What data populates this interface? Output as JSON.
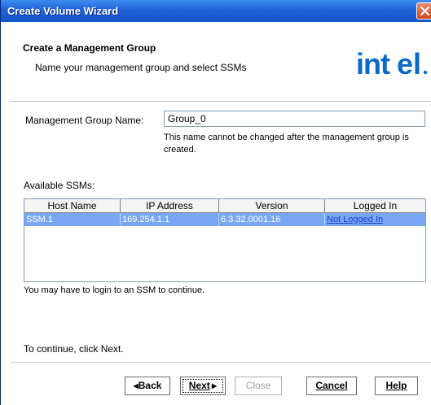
{
  "window": {
    "title": "Create Volume Wizard"
  },
  "header": {
    "title": "Create a Management Group",
    "subtitle": "Name your management group and select SSMs",
    "logo_text": "intel"
  },
  "form": {
    "name_label": "Management Group Name:",
    "name_value": "Group_0",
    "name_note": "This name cannot be changed after the management group is created.",
    "available_label": "Available SSMs:"
  },
  "table": {
    "columns": [
      "Host Name",
      "IP Address",
      "Version",
      "Logged In"
    ],
    "rows": [
      {
        "host": "SSM.1",
        "ip": "169.254.1.1",
        "version": "6.3.32.0001.16",
        "logged_in": "Not Logged In"
      }
    ]
  },
  "notes": {
    "login": "You may have to login to an SSM to continue.",
    "continue": "To continue, click Next."
  },
  "buttons": {
    "back": "Back",
    "next": "Next",
    "close": "Close",
    "cancel": "Cancel",
    "help": "Help"
  },
  "colors": {
    "titlebar": "#1f63d8",
    "selection": "#7aa7f5",
    "link": "#1a3fd0",
    "intel_blue": "#0a69c5"
  },
  "icons": {
    "close": "close-icon",
    "back": "triangle-left-icon",
    "next": "triangle-right-icon"
  }
}
